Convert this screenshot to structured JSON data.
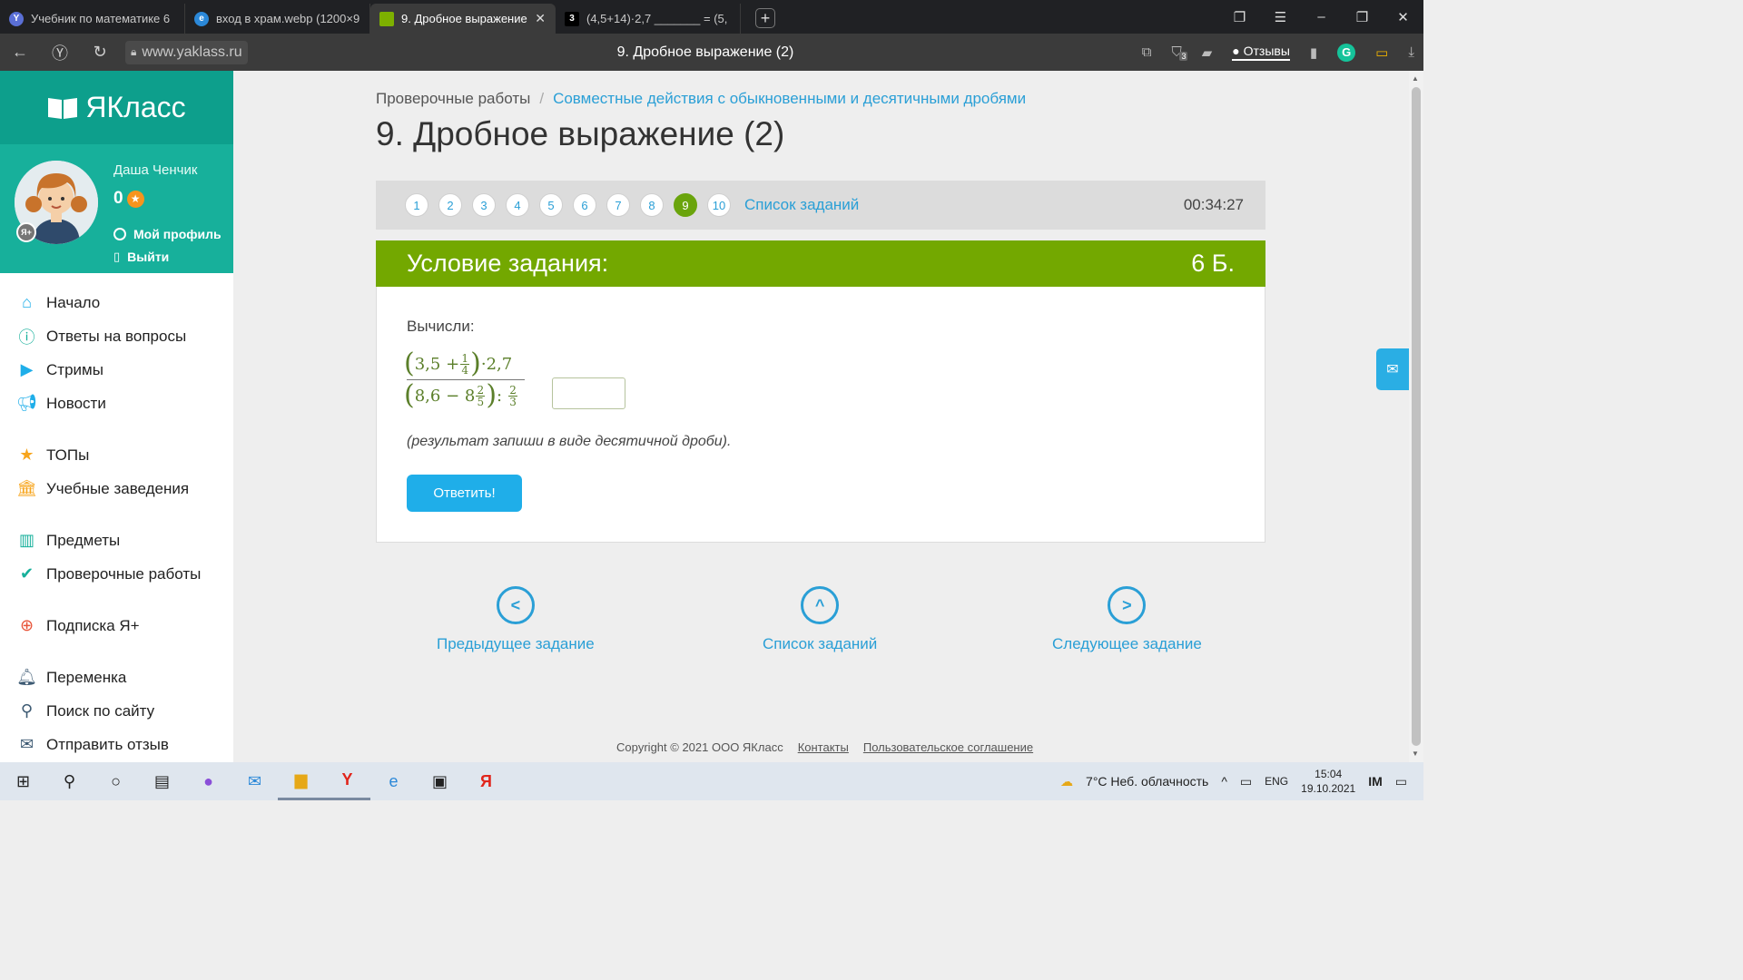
{
  "browser": {
    "tabs": [
      {
        "title": "Учебник по математике 6",
        "icon_color": "#5a6fd6",
        "active": false
      },
      {
        "title": "вход в храм.webp (1200×9",
        "icon_color": "#2b88d8",
        "active": false
      },
      {
        "title": "9. Дробное выражение",
        "icon_color": "#7db000",
        "active": true
      },
      {
        "title": "(4,5+14)·2,7 _______ = (5,",
        "icon_color": "#000000",
        "active": false
      }
    ],
    "new_tab_label": "+",
    "url": "www.yaklass.ru",
    "page_title": "9. Дробное выражение (2)",
    "reviews_label": "Отзывы",
    "badge_count": "3"
  },
  "sidebar": {
    "logo_text": "ЯКласс",
    "user_name": "Даша Ченчик",
    "points": "0",
    "profile_label": "Мой профиль",
    "logout_label": "Выйти",
    "ya_badge": "Я+",
    "menu": [
      [
        {
          "label": "Начало",
          "icon": "home-icon"
        },
        {
          "label": "Ответы на вопросы",
          "icon": "question-icon"
        },
        {
          "label": "Стримы",
          "icon": "stream-icon"
        },
        {
          "label": "Новости",
          "icon": "news-icon"
        }
      ],
      [
        {
          "label": "ТОПы",
          "icon": "star-icon"
        },
        {
          "label": "Учебные заведения",
          "icon": "school-icon"
        }
      ],
      [
        {
          "label": "Предметы",
          "icon": "books-icon"
        },
        {
          "label": "Проверочные работы",
          "icon": "check-icon"
        }
      ],
      [
        {
          "label": "Подписка Я+",
          "icon": "subscription-icon"
        }
      ],
      [
        {
          "label": "Переменка",
          "icon": "bell-icon"
        },
        {
          "label": "Поиск по сайту",
          "icon": "search-icon"
        },
        {
          "label": "Отправить отзыв",
          "icon": "feedback-icon"
        }
      ]
    ]
  },
  "main": {
    "breadcrumb_root": "Проверочные работы",
    "breadcrumb_sep": "/",
    "breadcrumb_current": "Совместные действия с обыкновенными и десятичными дробями",
    "title": "9. Дробное выражение (2)",
    "tasks": [
      "1",
      "2",
      "3",
      "4",
      "5",
      "6",
      "7",
      "8",
      "9",
      "10"
    ],
    "active_task": "9",
    "task_list_label": "Список заданий",
    "timer": "00:34:27",
    "condition_label": "Условие задания:",
    "points_label": "6 Б.",
    "calc_label": "Вычисли:",
    "formula": {
      "num_a": "3,5 +",
      "num_frac_n": "1",
      "num_frac_d": "4",
      "num_tail": "·2,7",
      "den_a": "8,6 − 8",
      "den_frac_n": "2",
      "den_frac_d": "5",
      "den_mid": ":",
      "den_frac2_n": "2",
      "den_frac2_d": "3",
      "equals": "="
    },
    "hint": "(результат запиши в виде десятичной дроби).",
    "submit_label": "Ответить!",
    "prev_label": "Предыдущее задание",
    "list_label": "Список заданий",
    "next_label": "Следующее задание",
    "footer_copy": "Copyright © 2021 ООО ЯКласс",
    "footer_contacts": "Контакты",
    "footer_terms": "Пользовательское соглашение"
  },
  "taskbar": {
    "weather": "7°C  Неб. облачность",
    "lang": "ENG",
    "time": "15:04",
    "date": "19.10.2021"
  },
  "colors": {
    "brand_teal": "#17b09b",
    "condition_green": "#73a800",
    "link_blue": "#2a9fd6",
    "button_blue": "#1faee9"
  }
}
